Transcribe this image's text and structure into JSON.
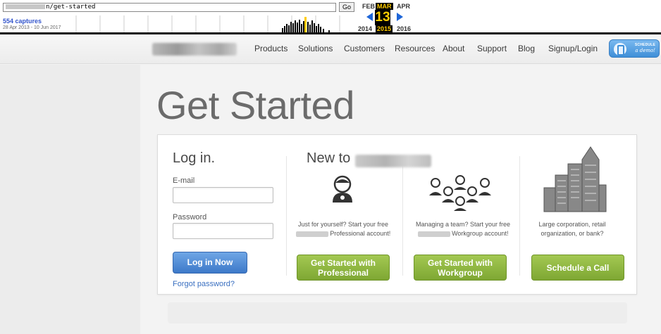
{
  "wayback": {
    "url_suffix": "n/get-started",
    "go_label": "Go",
    "captures": "554 captures",
    "range": "28 Apr 2013 - 10 Jun 2017",
    "months": {
      "prev": "FEB",
      "current": "MAR",
      "next": "APR"
    },
    "day": "13",
    "years": {
      "prev": "2014",
      "current": "2015",
      "next": "2016"
    }
  },
  "nav": {
    "items": [
      "Products",
      "Solutions",
      "Customers",
      "Resources",
      "About",
      "Support",
      "Blog",
      "Signup/Login"
    ],
    "demo_top": "SCHEDULE",
    "demo_bottom": "a demo!"
  },
  "page": {
    "title": "Get Started"
  },
  "login": {
    "heading": "Log in.",
    "email_label": "E-mail",
    "password_label": "Password",
    "button": "Log in Now",
    "forgot": "Forgot password?"
  },
  "signup": {
    "heading": "New to",
    "professional": {
      "desc_line1": "Just for yourself? Start your free",
      "desc_line2": "Professional account!",
      "button": "Get Started with Professional"
    },
    "workgroup": {
      "desc_line1": "Managing a team? Start your free",
      "desc_line2": "Workgroup account!",
      "button": "Get Started with Workgroup"
    },
    "enterprise": {
      "desc_line1": "Large corporation, retail",
      "desc_line2": "organization, or bank?",
      "button": "Schedule a Call"
    }
  },
  "colors": {
    "blue_button": "#4f89d6",
    "green_button": "#8db43e",
    "link": "#3a6fc0",
    "title": "#6b6b6b"
  }
}
